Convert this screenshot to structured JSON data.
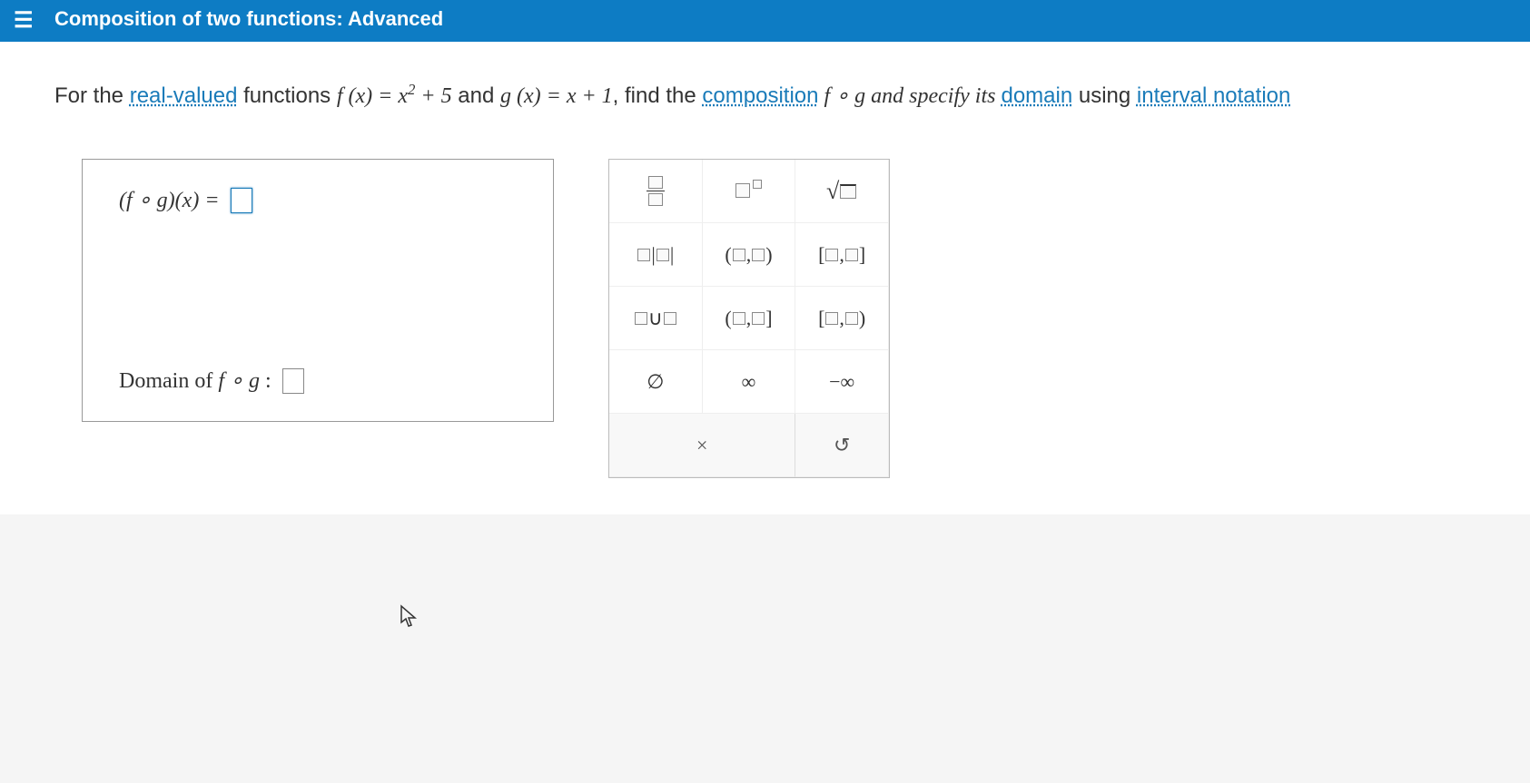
{
  "header": {
    "title": "Composition of two functions: Advanced"
  },
  "question": {
    "prefix": "For the ",
    "link1": "real-valued",
    "mid1": " functions ",
    "fx": "f (x) = x",
    "fx_exp": "2",
    "fx_tail": " + 5",
    "and": " and ",
    "gx": "g (x) = x + 1",
    "mid2": ", find the ",
    "link2": "composition",
    "mid3": " f ∘ g and specify its ",
    "link3": "domain",
    "mid4": " using ",
    "link4": "interval notation"
  },
  "answer": {
    "composition_label": "(f ∘ g)(x) = ",
    "domain_label": "Domain of f ∘ g : "
  },
  "toolbox": {
    "fraction": "fraction",
    "exponent": "exponent",
    "sqrt": "√",
    "abs": "absolute-value",
    "open_interval": "(□,□)",
    "closed_interval": "[□,□]",
    "union": "□∪□",
    "half_open1": "(□,□]",
    "half_open2": "[□,□)",
    "emptyset": "∅",
    "infinity": "∞",
    "neg_infinity": "−∞",
    "clear": "×",
    "reset": "↺"
  }
}
